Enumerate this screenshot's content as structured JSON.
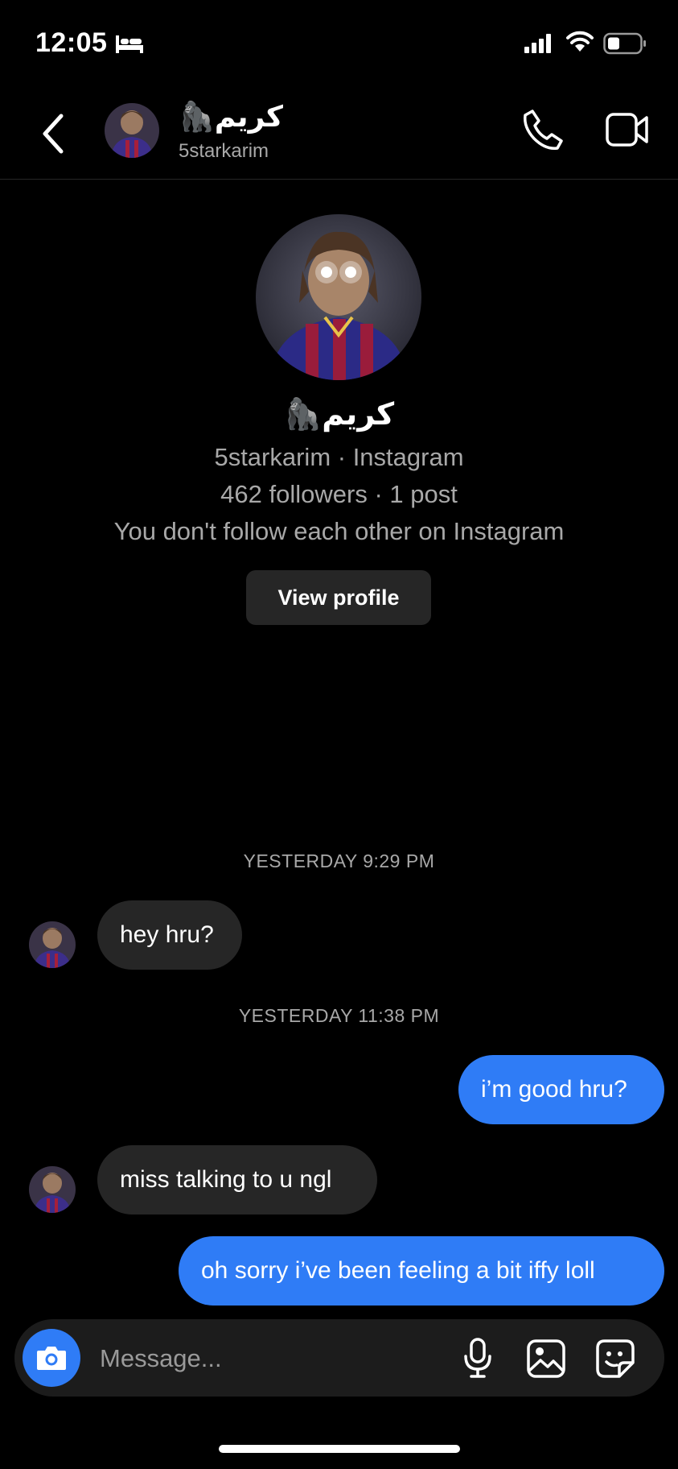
{
  "status_bar": {
    "time": "12:05"
  },
  "header": {
    "name": "🦍كريم",
    "username": "5starkarim"
  },
  "profile": {
    "name": "🦍كريم",
    "line1": "5starkarim · Instagram",
    "line2": "462 followers · 1 post",
    "line3": "You don't follow each other on Instagram",
    "view_profile_label": "View profile"
  },
  "messages": {
    "timestamp1": "YESTERDAY 9:29 PM",
    "timestamp2": "YESTERDAY 11:38 PM",
    "m1": "hey hru?",
    "m2": "i’m good hru?",
    "m3": "miss talking to u ngl",
    "m4": "oh sorry i’ve been feeling a bit iffy loll"
  },
  "composer": {
    "placeholder": "Message..."
  },
  "colors": {
    "background": "#000000",
    "outgoing_bubble": "#2f7cf6",
    "incoming_bubble": "#262626",
    "secondary_text": "#a8a8a8"
  },
  "icons": [
    "bed-icon",
    "signal-icon",
    "wifi-icon",
    "battery-icon",
    "back-icon",
    "phone-icon",
    "video-icon",
    "camera-icon",
    "microphone-icon",
    "gallery-icon",
    "sticker-icon"
  ]
}
